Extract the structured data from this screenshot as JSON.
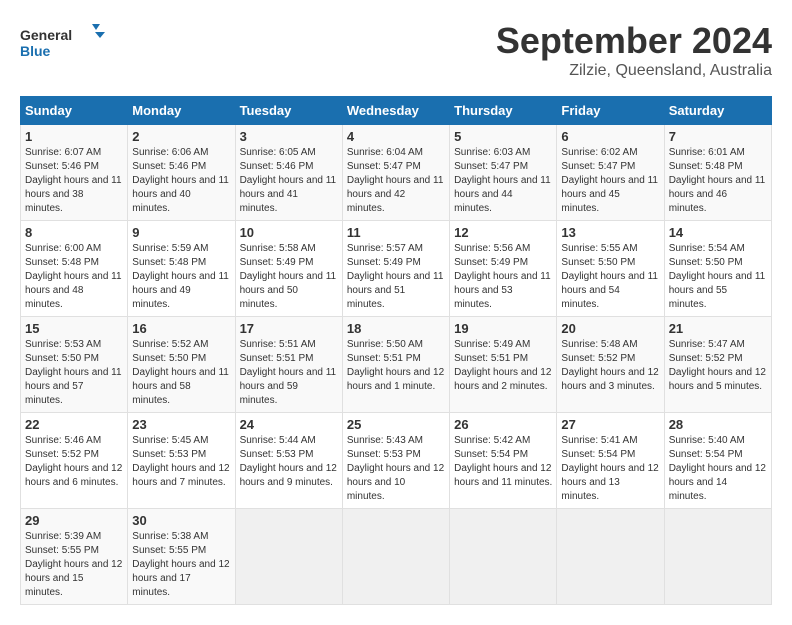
{
  "header": {
    "logo_general": "General",
    "logo_blue": "Blue",
    "month": "September 2024",
    "location": "Zilzie, Queensland, Australia"
  },
  "columns": [
    "Sunday",
    "Monday",
    "Tuesday",
    "Wednesday",
    "Thursday",
    "Friday",
    "Saturday"
  ],
  "weeks": [
    [
      {
        "day": "1",
        "sunrise": "6:07 AM",
        "sunset": "5:46 PM",
        "daylight": "11 hours and 38 minutes."
      },
      {
        "day": "2",
        "sunrise": "6:06 AM",
        "sunset": "5:46 PM",
        "daylight": "11 hours and 40 minutes."
      },
      {
        "day": "3",
        "sunrise": "6:05 AM",
        "sunset": "5:46 PM",
        "daylight": "11 hours and 41 minutes."
      },
      {
        "day": "4",
        "sunrise": "6:04 AM",
        "sunset": "5:47 PM",
        "daylight": "11 hours and 42 minutes."
      },
      {
        "day": "5",
        "sunrise": "6:03 AM",
        "sunset": "5:47 PM",
        "daylight": "11 hours and 44 minutes."
      },
      {
        "day": "6",
        "sunrise": "6:02 AM",
        "sunset": "5:47 PM",
        "daylight": "11 hours and 45 minutes."
      },
      {
        "day": "7",
        "sunrise": "6:01 AM",
        "sunset": "5:48 PM",
        "daylight": "11 hours and 46 minutes."
      }
    ],
    [
      {
        "day": "8",
        "sunrise": "6:00 AM",
        "sunset": "5:48 PM",
        "daylight": "11 hours and 48 minutes."
      },
      {
        "day": "9",
        "sunrise": "5:59 AM",
        "sunset": "5:48 PM",
        "daylight": "11 hours and 49 minutes."
      },
      {
        "day": "10",
        "sunrise": "5:58 AM",
        "sunset": "5:49 PM",
        "daylight": "11 hours and 50 minutes."
      },
      {
        "day": "11",
        "sunrise": "5:57 AM",
        "sunset": "5:49 PM",
        "daylight": "11 hours and 51 minutes."
      },
      {
        "day": "12",
        "sunrise": "5:56 AM",
        "sunset": "5:49 PM",
        "daylight": "11 hours and 53 minutes."
      },
      {
        "day": "13",
        "sunrise": "5:55 AM",
        "sunset": "5:50 PM",
        "daylight": "11 hours and 54 minutes."
      },
      {
        "day": "14",
        "sunrise": "5:54 AM",
        "sunset": "5:50 PM",
        "daylight": "11 hours and 55 minutes."
      }
    ],
    [
      {
        "day": "15",
        "sunrise": "5:53 AM",
        "sunset": "5:50 PM",
        "daylight": "11 hours and 57 minutes."
      },
      {
        "day": "16",
        "sunrise": "5:52 AM",
        "sunset": "5:50 PM",
        "daylight": "11 hours and 58 minutes."
      },
      {
        "day": "17",
        "sunrise": "5:51 AM",
        "sunset": "5:51 PM",
        "daylight": "11 hours and 59 minutes."
      },
      {
        "day": "18",
        "sunrise": "5:50 AM",
        "sunset": "5:51 PM",
        "daylight": "12 hours and 1 minute."
      },
      {
        "day": "19",
        "sunrise": "5:49 AM",
        "sunset": "5:51 PM",
        "daylight": "12 hours and 2 minutes."
      },
      {
        "day": "20",
        "sunrise": "5:48 AM",
        "sunset": "5:52 PM",
        "daylight": "12 hours and 3 minutes."
      },
      {
        "day": "21",
        "sunrise": "5:47 AM",
        "sunset": "5:52 PM",
        "daylight": "12 hours and 5 minutes."
      }
    ],
    [
      {
        "day": "22",
        "sunrise": "5:46 AM",
        "sunset": "5:52 PM",
        "daylight": "12 hours and 6 minutes."
      },
      {
        "day": "23",
        "sunrise": "5:45 AM",
        "sunset": "5:53 PM",
        "daylight": "12 hours and 7 minutes."
      },
      {
        "day": "24",
        "sunrise": "5:44 AM",
        "sunset": "5:53 PM",
        "daylight": "12 hours and 9 minutes."
      },
      {
        "day": "25",
        "sunrise": "5:43 AM",
        "sunset": "5:53 PM",
        "daylight": "12 hours and 10 minutes."
      },
      {
        "day": "26",
        "sunrise": "5:42 AM",
        "sunset": "5:54 PM",
        "daylight": "12 hours and 11 minutes."
      },
      {
        "day": "27",
        "sunrise": "5:41 AM",
        "sunset": "5:54 PM",
        "daylight": "12 hours and 13 minutes."
      },
      {
        "day": "28",
        "sunrise": "5:40 AM",
        "sunset": "5:54 PM",
        "daylight": "12 hours and 14 minutes."
      }
    ],
    [
      {
        "day": "29",
        "sunrise": "5:39 AM",
        "sunset": "5:55 PM",
        "daylight": "12 hours and 15 minutes."
      },
      {
        "day": "30",
        "sunrise": "5:38 AM",
        "sunset": "5:55 PM",
        "daylight": "12 hours and 17 minutes."
      },
      null,
      null,
      null,
      null,
      null
    ]
  ]
}
